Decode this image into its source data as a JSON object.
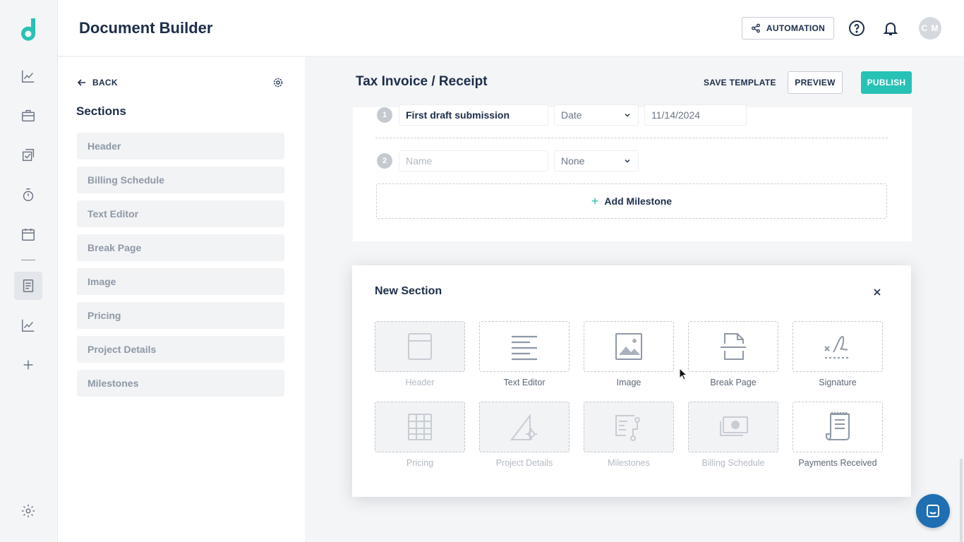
{
  "app": {
    "title": "Document Builder",
    "avatar_initials": "C M",
    "accent_color": "#27c2b6",
    "logo_color": "#27c2b6"
  },
  "header": {
    "automation_label": "AUTOMATION"
  },
  "rail": {
    "icons": [
      "analytics-icon",
      "briefcase-icon",
      "tasks-icon",
      "timer-icon",
      "calendar-icon",
      "document-icon",
      "reports-icon",
      "plus-icon",
      "settings-icon"
    ]
  },
  "sections_panel": {
    "back_label": "BACK",
    "heading": "Sections",
    "items": [
      "Header",
      "Billing Schedule",
      "Text Editor",
      "Break Page",
      "Image",
      "Pricing",
      "Project Details",
      "Milestones"
    ]
  },
  "document": {
    "title": "Tax Invoice / Receipt",
    "save_template_label": "SAVE TEMPLATE",
    "preview_label": "PREVIEW",
    "publish_label": "PUBLISH"
  },
  "milestones": {
    "rows": [
      {
        "num": "1",
        "name": "First draft submission",
        "name_placeholder": "",
        "type": "Date",
        "date": "11/14/2024"
      },
      {
        "num": "2",
        "name": "",
        "name_placeholder": "Name",
        "type": "None",
        "date": ""
      }
    ],
    "add_label": "Add Milestone"
  },
  "new_section_modal": {
    "title": "New Section",
    "tiles": [
      {
        "label": "Header",
        "enabled": false,
        "icon": "header-icon"
      },
      {
        "label": "Text Editor",
        "enabled": true,
        "icon": "text-lines-icon"
      },
      {
        "label": "Image",
        "enabled": true,
        "icon": "image-icon"
      },
      {
        "label": "Break Page",
        "enabled": true,
        "icon": "break-page-icon"
      },
      {
        "label": "Signature",
        "enabled": true,
        "icon": "signature-icon"
      },
      {
        "label": "Pricing",
        "enabled": false,
        "icon": "pricing-grid-icon"
      },
      {
        "label": "Project Details",
        "enabled": false,
        "icon": "project-details-icon"
      },
      {
        "label": "Milestones",
        "enabled": false,
        "icon": "milestones-icon"
      },
      {
        "label": "Billing Schedule",
        "enabled": false,
        "icon": "billing-icon"
      },
      {
        "label": "Payments Received",
        "enabled": true,
        "icon": "receipt-icon"
      }
    ]
  }
}
